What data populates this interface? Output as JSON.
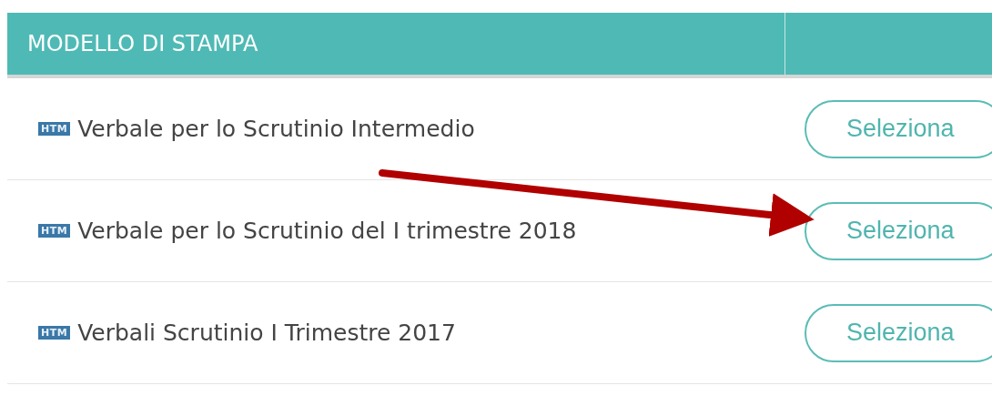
{
  "table": {
    "columns": [
      "MODELLO DI STAMPA",
      ""
    ],
    "rows": [
      {
        "badge": "HTM",
        "title": "Verbale per lo Scrutinio Intermedio",
        "button": "Seleziona"
      },
      {
        "badge": "HTM",
        "title": "Verbale per lo Scrutinio del I trimestre 2018",
        "button": "Seleziona"
      },
      {
        "badge": "HTM",
        "title": "Verbali Scrutinio I Trimestre 2017",
        "button": "Seleziona"
      }
    ]
  }
}
